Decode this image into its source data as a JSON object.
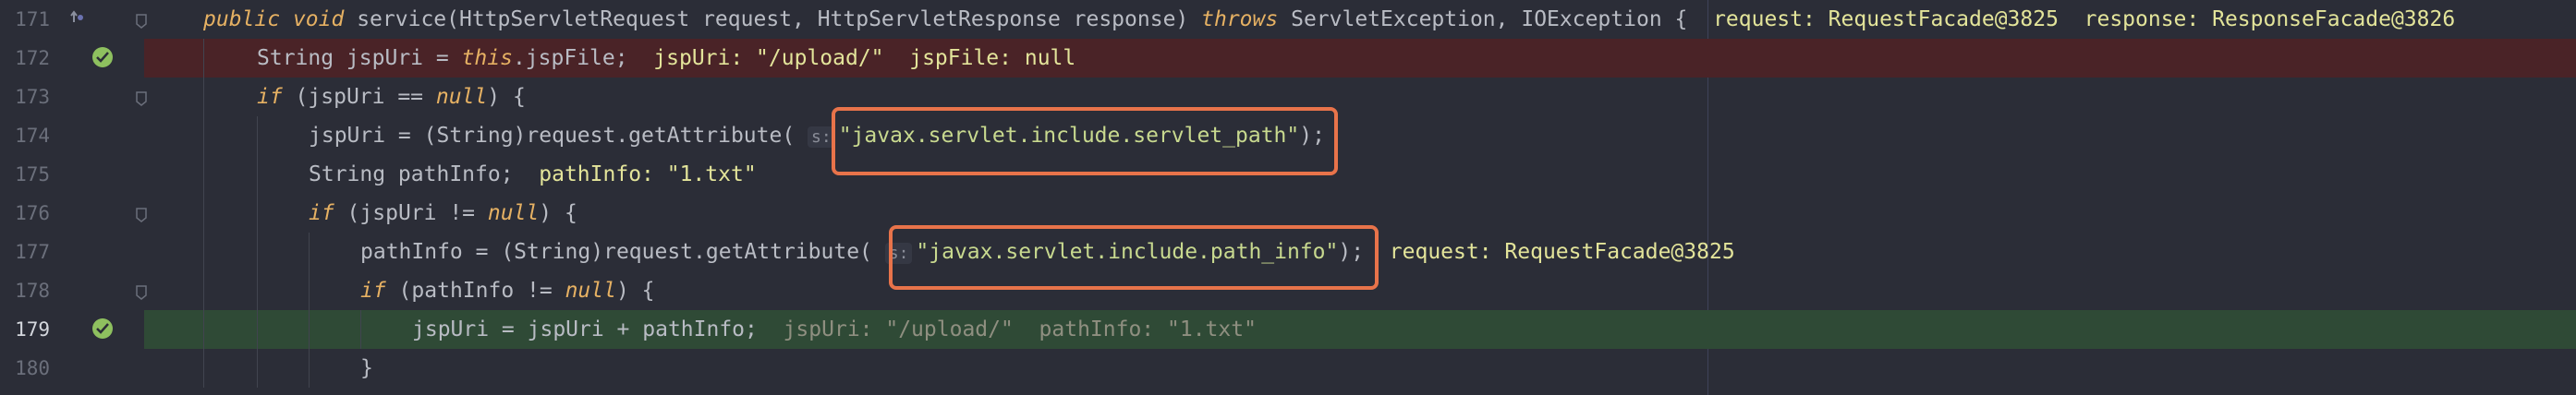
{
  "editor": {
    "lines": [
      {
        "number": "171",
        "parts": {
          "modifier": "public",
          "void": "void",
          "signature": "service(HttpServletRequest request, HttpServletResponse response)",
          "throws": "throws",
          "exceptions": "ServletException, IOException {",
          "inline": "request: RequestFacade@3825  response: ResponseFacade@3826"
        }
      },
      {
        "number": "172",
        "parts": {
          "pre": "String jspUri = ",
          "this": "this",
          "post": ".jspFile;",
          "inline": "jspUri: \"/upload/\"  jspFile: null"
        }
      },
      {
        "number": "173",
        "parts": {
          "if": "if",
          "mid": " (jspUri == ",
          "null": "null",
          "post": ") {"
        }
      },
      {
        "number": "174",
        "parts": {
          "pre": "jspUri = (String)request.getAttribute( ",
          "hint": "s:",
          "str": "\"javax.servlet.include.servlet_path\"",
          "post": ");"
        }
      },
      {
        "number": "175",
        "parts": {
          "pre": "String pathInfo;",
          "inline": "pathInfo: \"1.txt\""
        }
      },
      {
        "number": "176",
        "parts": {
          "if": "if",
          "mid": " (jspUri != ",
          "null": "null",
          "post": ") {"
        }
      },
      {
        "number": "177",
        "parts": {
          "pre": "pathInfo = (String)request.getAttribute( ",
          "hint": "s:",
          "str": "\"javax.servlet.include.path_info\"",
          "post": ");",
          "inline": "request: RequestFacade@3825"
        }
      },
      {
        "number": "178",
        "parts": {
          "if": "if",
          "mid": " (pathInfo != ",
          "null": "null",
          "post": ") {"
        }
      },
      {
        "number": "179",
        "parts": {
          "pre": "jspUri = jspUri + pathInfo;",
          "inline": "jspUri: \"/upload/\"  pathInfo: \"1.txt\""
        }
      },
      {
        "number": "180",
        "parts": {
          "pre": "}"
        }
      }
    ]
  },
  "colors": {
    "background": "#2b2d37",
    "breakpoint_line": "#4a2327",
    "execution_line": "#2f4a36",
    "keyword": "#e6b163",
    "string": "#c8d98f",
    "inline_value": "#e3e49a",
    "highlight_box": "#e8734a",
    "breakpoint_icon": "#8ec05f"
  },
  "icons": {
    "override": "override-arrow-icon",
    "breakpoint": "breakpoint-check-icon",
    "fold": "fold-marker-icon"
  }
}
